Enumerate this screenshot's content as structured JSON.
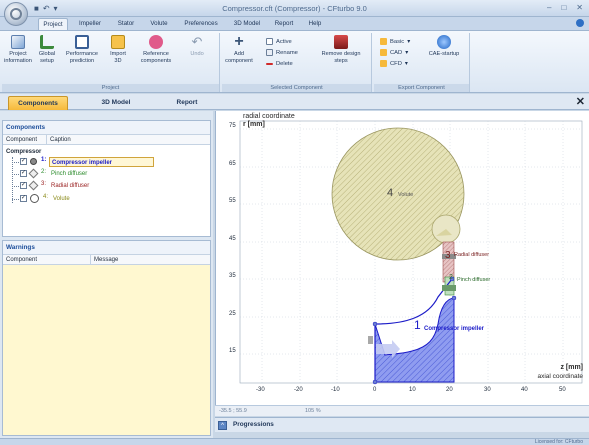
{
  "app": {
    "window_title": "Compressor.cft (Compressor) - CFturbo 9.0"
  },
  "ribbon_tabs": [
    "Project",
    "Impeller",
    "Stator",
    "Volute",
    "Preferences",
    "3D Model",
    "Report",
    "Help"
  ],
  "ribbon": {
    "groups": {
      "project": "Project",
      "selected_component": "Selected Component",
      "export_component": "Export Component"
    },
    "buttons": {
      "project_information": "Project information",
      "global_setup": "Global setup",
      "performance_prediction": "Performance prediction",
      "import_3d": "Import 3D",
      "reference_components": "Reference components",
      "undo": "Undo",
      "add_component": "Add component",
      "active": "Active",
      "rename": "Rename",
      "delete": "Delete",
      "remove_design_steps": "Remove design steps",
      "basic": "Basic",
      "cad": "CAD",
      "cfd": "CFD",
      "cae_startup": "CAE-startup"
    }
  },
  "panel_tabs": [
    "Components",
    "3D Model",
    "Report"
  ],
  "components_panel": {
    "title": "Components",
    "columns": [
      "Component",
      "Caption"
    ],
    "root": "Compressor",
    "items": [
      {
        "num": "1:",
        "caption": "Compressor impeller",
        "color": "#1c1cc8"
      },
      {
        "num": "2:",
        "caption": "Pinch diffuser",
        "color": "#2a8a2a"
      },
      {
        "num": "3:",
        "caption": "Radial diffuser",
        "color": "#9a2222"
      },
      {
        "num": "4:",
        "caption": "Volute",
        "color": "#8a8a18"
      }
    ]
  },
  "warnings_panel": {
    "title": "Warnings",
    "columns": [
      "Component",
      "Message"
    ]
  },
  "plot": {
    "y_axis_caption": "radial coordinate",
    "y_axis_unit": "r [mm]",
    "x_axis_unit": "z [mm]",
    "x_axis_caption": "axial coordinate",
    "y_ticks": [
      "75",
      "65",
      "55",
      "45",
      "35",
      "25",
      "15"
    ],
    "x_ticks": [
      "-30",
      "-20",
      "-10",
      "0",
      "10",
      "20",
      "30",
      "40",
      "50"
    ],
    "labels": {
      "volute": "4",
      "volute_text": "Volute",
      "radial": "3",
      "radial_text": "Radial diffuser",
      "pinch": "2",
      "pinch_text": "Pinch diffuser",
      "impeller": "1",
      "impeller_text": "Compressor impeller"
    }
  },
  "status": {
    "coords": "-35.5 ; 55.9",
    "zoom": "105 %"
  },
  "progressions": {
    "label": "Progressions",
    "expand_glyph": "^"
  },
  "statusbar": {
    "license": "Licensed for: CFturbo"
  },
  "icons": {
    "window_controls": [
      "minimize-icon",
      "maximize-icon",
      "close-icon"
    ],
    "help": "help-icon",
    "checkbox": "checkbox-checked-icon"
  }
}
